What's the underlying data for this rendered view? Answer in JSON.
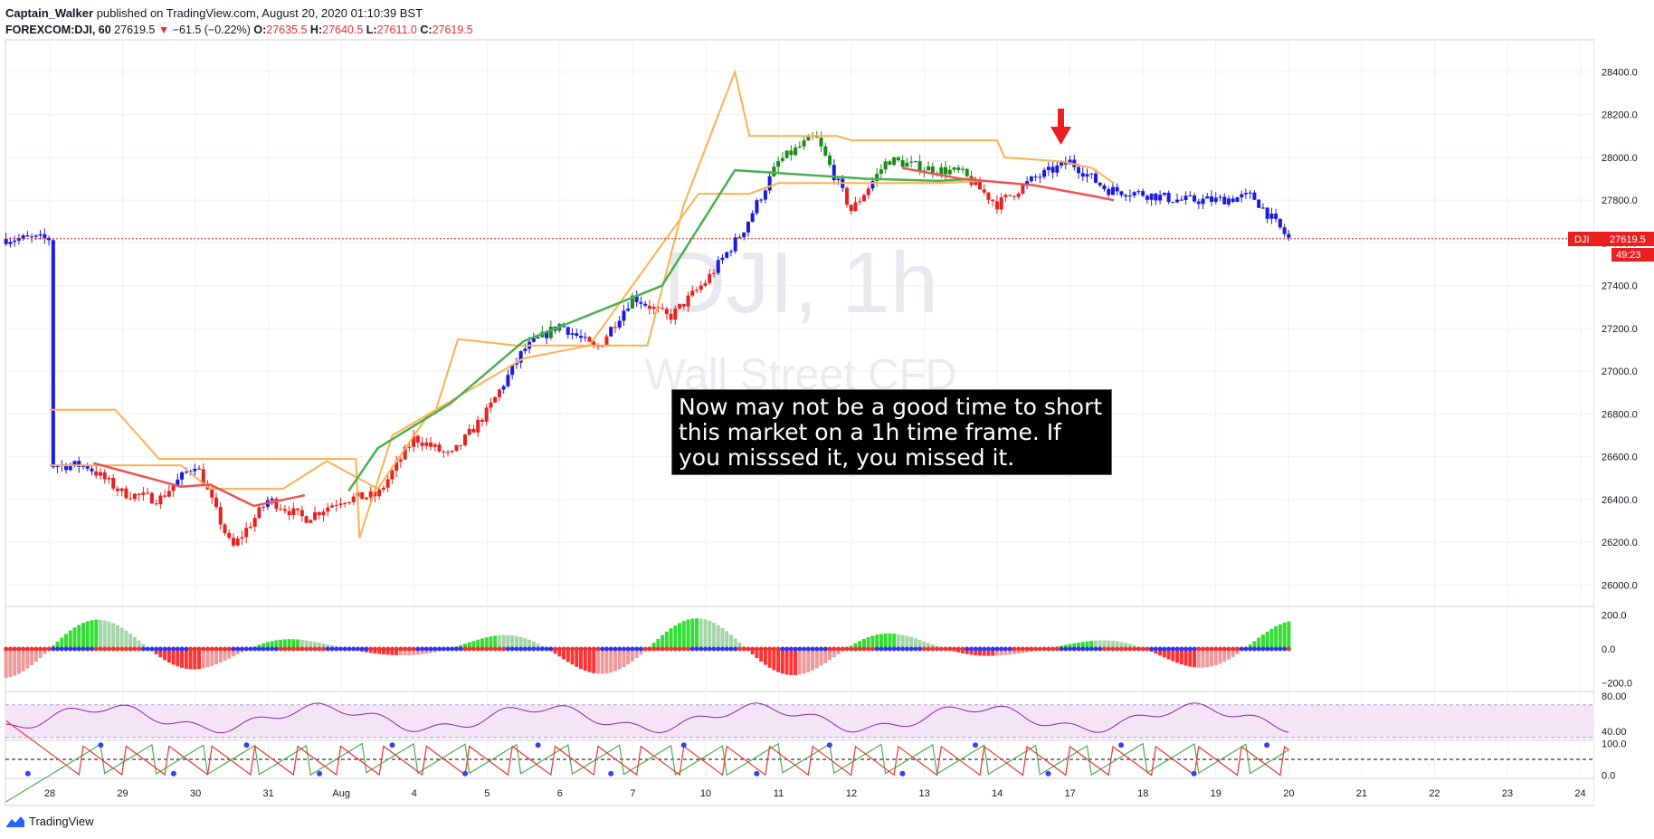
{
  "header": {
    "author": "Captain_Walker",
    "published_text": "published on TradingView.com, August 20, 2020 01:10:39 BST",
    "symbol": "FOREXCOM:DJI, 60",
    "last": "27619.5",
    "arrow": "▼",
    "change": "−61.5 (−0.22%)",
    "o_label": "O:",
    "o_value": "27635.5",
    "h_label": "H:",
    "h_value": "27640.5",
    "l_label": "L:",
    "l_value": "27611.0",
    "c_label": "C:",
    "c_value": "27619.5"
  },
  "watermark": {
    "symbol": "DJI, 1h",
    "name": "Wall Street CFD"
  },
  "annotation": "Now may not be a good time to short this market on a 1h time frame. If you misssed it, you missed it.",
  "price_tag": {
    "symbol": "DJI",
    "price": "27619.5",
    "countdown": "49:23"
  },
  "footer": {
    "brand": "TradingView"
  },
  "colors": {
    "up": "#2e7d32",
    "upbar": "#1b8a1b",
    "blue": "#1a1adf",
    "down": "#e82020",
    "orange": "#ffb050",
    "green_ma": "#4caf50",
    "red_ma": "#ef5350",
    "rsi": "#8e24aa",
    "rsi_band": "#f3e5f5"
  },
  "chart_data": [
    {
      "type": "candlestick",
      "symbol": "FOREXCOM:DJI",
      "interval": "60",
      "ylim": [
        25900,
        28550
      ],
      "y_ticks": [
        "28400.0",
        "28200.0",
        "28000.0",
        "27800.0",
        "27600.0",
        "27400.0",
        "27200.0",
        "27000.0",
        "26800.0",
        "26600.0",
        "26400.0",
        "26200.0",
        "26000.0"
      ],
      "x_ticks": [
        "28",
        "29",
        "30",
        "31",
        "Aug",
        "4",
        "5",
        "6",
        "7",
        "10",
        "11",
        "12",
        "13",
        "14",
        "17",
        "18",
        "19",
        "20",
        "21",
        "22",
        "23",
        "24"
      ],
      "price_path": [
        [
          "28",
          26560
        ],
        [
          "28.5",
          26560
        ],
        [
          "29",
          26430
        ],
        [
          "29.5",
          26400
        ],
        [
          "30",
          26570
        ],
        [
          "30.5",
          26170
        ],
        [
          "31",
          26400
        ],
        [
          "31.5",
          26310
        ],
        [
          "Aug",
          26400
        ],
        [
          "Aug.5",
          26420
        ],
        [
          "4",
          26690
        ],
        [
          "4.5",
          26600
        ],
        [
          "5",
          26810
        ],
        [
          "5.5",
          27100
        ],
        [
          "6",
          27220
        ],
        [
          "6.5",
          27100
        ],
        [
          "7",
          27350
        ],
        [
          "7.5",
          27250
        ],
        [
          "10",
          27420
        ],
        [
          "10.5",
          27650
        ],
        [
          "11",
          27980
        ],
        [
          "11.5",
          28100
        ],
        [
          "12",
          27750
        ],
        [
          "12.5",
          27990
        ],
        [
          "13",
          27950
        ],
        [
          "13.5",
          27930
        ],
        [
          "14",
          27780
        ],
        [
          "14.5",
          27900
        ],
        [
          "17",
          27980
        ],
        [
          "17.5",
          27850
        ],
        [
          "18",
          27830
        ],
        [
          "18.5",
          27800
        ],
        [
          "19",
          27800
        ],
        [
          "19.5",
          27820
        ],
        [
          "20",
          27619.5
        ]
      ],
      "upper_band": [
        [
          0,
          26820
        ],
        [
          0.9,
          26820
        ],
        [
          1.5,
          26590
        ],
        [
          4.2,
          26590
        ],
        [
          4.25,
          26220
        ],
        [
          4.7,
          26700
        ],
        [
          5.3,
          26820
        ],
        [
          5.6,
          27150
        ],
        [
          6.4,
          27120
        ],
        [
          8.2,
          27120
        ],
        [
          8.7,
          27780
        ],
        [
          9.4,
          28400
        ],
        [
          9.6,
          28100
        ],
        [
          10.8,
          28100
        ],
        [
          11,
          28080
        ],
        [
          13,
          28080
        ],
        [
          13.1,
          28000
        ],
        [
          13.9,
          27980
        ],
        [
          14.3,
          27950
        ],
        [
          14.6,
          27880
        ]
      ],
      "lower_band": [
        [
          0,
          26560
        ],
        [
          1.8,
          26560
        ],
        [
          2.2,
          26450
        ],
        [
          3.2,
          26450
        ],
        [
          3.8,
          26580
        ],
        [
          4.5,
          26450
        ],
        [
          5.2,
          26800
        ],
        [
          6.5,
          27060
        ],
        [
          7.4,
          27120
        ],
        [
          8.9,
          27830
        ],
        [
          9.6,
          27830
        ],
        [
          10,
          27880
        ],
        [
          10.8,
          27880
        ],
        [
          12.2,
          27880
        ],
        [
          12.8,
          27890
        ]
      ],
      "green_ma": [
        [
          4.1,
          26440
        ],
        [
          4.5,
          26640
        ],
        [
          5.5,
          26850
        ],
        [
          6.5,
          27140
        ],
        [
          8.4,
          27400
        ],
        [
          9.4,
          27940
        ],
        [
          11.2,
          27900
        ],
        [
          12.2,
          27890
        ],
        [
          12.7,
          27900
        ]
      ],
      "red_ma": [
        [
          0.6,
          26570
        ],
        [
          1.8,
          26460
        ],
        [
          2.2,
          26470
        ],
        [
          2.8,
          26370
        ],
        [
          3.5,
          26420
        ],
        [
          11.7,
          27950
        ],
        [
          12.5,
          27900
        ],
        [
          13.5,
          27870
        ],
        [
          14.3,
          27820
        ],
        [
          14.6,
          27800
        ]
      ]
    },
    {
      "type": "histogram",
      "name": "momentum",
      "ylim": [
        -250,
        250
      ],
      "y_ticks": [
        "200.0",
        "0.0",
        "−200.0"
      ]
    },
    {
      "type": "line",
      "name": "rsi",
      "ylim": [
        30,
        85
      ],
      "y_ticks": [
        "80.00",
        "40.00"
      ],
      "band": [
        33,
        70
      ]
    },
    {
      "type": "line",
      "name": "oscillator",
      "ylim": [
        -10,
        110
      ],
      "y_ticks": [
        "100.0",
        "0.0"
      ]
    }
  ]
}
